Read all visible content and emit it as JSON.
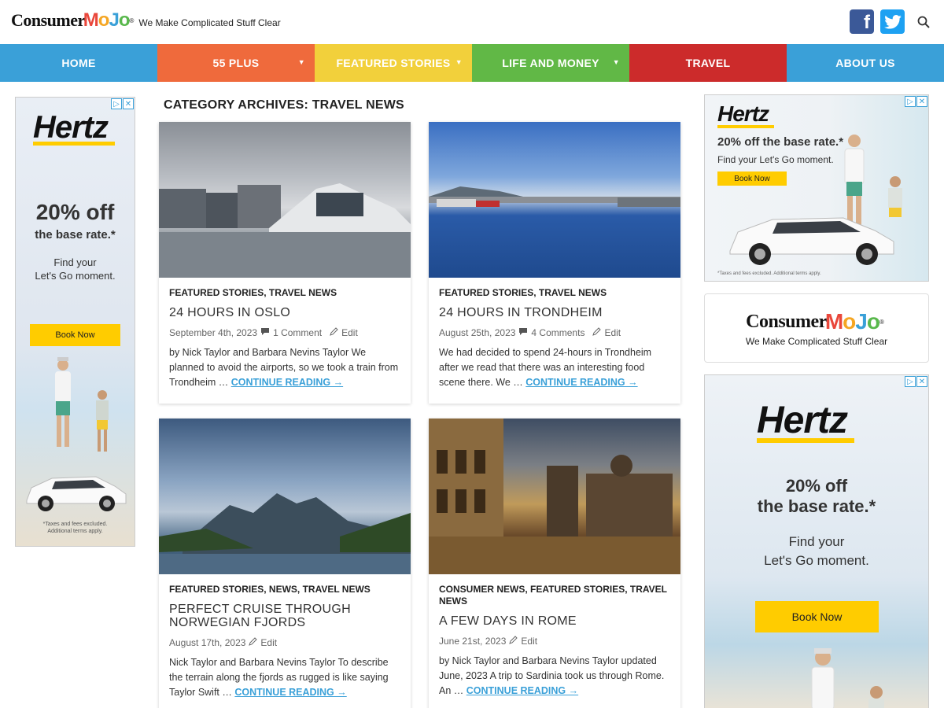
{
  "header": {
    "logo_word": "Consumer",
    "logo_mojo": [
      "M",
      "o",
      "J",
      "o"
    ],
    "logo_reg": "®",
    "tagline": "We Make Complicated Stuff Clear",
    "fb_glyph": "f"
  },
  "nav": [
    {
      "label": "HOME",
      "color": "#3aa0d8",
      "has_sub": false
    },
    {
      "label": "55 PLUS",
      "color": "#ef6a3c",
      "has_sub": true
    },
    {
      "label": "FEATURED STORIES",
      "color": "#f2d03b",
      "has_sub": true
    },
    {
      "label": "LIFE AND MONEY",
      "color": "#61b846",
      "has_sub": true
    },
    {
      "label": "TRAVEL",
      "color": "#cc2b2b",
      "has_sub": false
    },
    {
      "label": "ABOUT US",
      "color": "#3aa0d8",
      "has_sub": false
    }
  ],
  "nav_caret": "▼",
  "category_title": "CATEGORY ARCHIVES: TRAVEL NEWS",
  "ads": {
    "adchoice_icon": "▷",
    "adchoice_close": "✕",
    "brand": "Hertz",
    "offer_line1": "20% off",
    "offer_line2": "the base rate.*",
    "offer_single": "20% off the base rate.*",
    "find_line1": "Find your",
    "find_line2": "Let's Go moment.",
    "find_single": "Find your Let's Go moment.",
    "book": "Book Now",
    "fine_left": "*Taxes and fees excluded. Additional terms apply.",
    "fine_right": "*Taxes and fees excluded. Additional terms apply."
  },
  "posts": [
    {
      "cats": "FEATURED STORIES, TRAVEL NEWS",
      "title": "24 HOURS IN OSLO",
      "date": "September 4th, 2023",
      "comments": "1 Comment",
      "edit": "Edit",
      "excerpt": "by Nick Taylor and Barbara Nevins Taylor We planned to avoid the airports, so we took a train from Trondheim …",
      "more": "CONTINUE READING →"
    },
    {
      "cats": "FEATURED STORIES, TRAVEL NEWS",
      "title": "24 HOURS IN TRONDHEIM",
      "date": "August 25th, 2023",
      "comments": "4 Comments",
      "edit": "Edit",
      "excerpt": " We had decided to spend 24-hours in Trondheim after we read that there was an interesting food scene there. We …",
      "more": "CONTINUE READING →"
    },
    {
      "cats": "FEATURED STORIES, NEWS, TRAVEL NEWS",
      "title": "PERFECT CRUISE THROUGH NORWEGIAN FJORDS",
      "date": "August 17th, 2023",
      "comments": "",
      "edit": "Edit",
      "excerpt": "Nick Taylor and Barbara Nevins Taylor To describe the terrain along the fjords as rugged is like saying Taylor Swift …",
      "more": "CONTINUE READING →"
    },
    {
      "cats": "CONSUMER NEWS, FEATURED STORIES, TRAVEL NEWS",
      "title": "A FEW DAYS IN ROME",
      "date": "June 21st, 2023",
      "comments": "",
      "edit": "Edit",
      "excerpt": " by Nick Taylor and Barbara Nevins Taylor updated June, 2023 A trip to Sardinia took us through Rome. An …",
      "more": "CONTINUE READING →"
    }
  ]
}
